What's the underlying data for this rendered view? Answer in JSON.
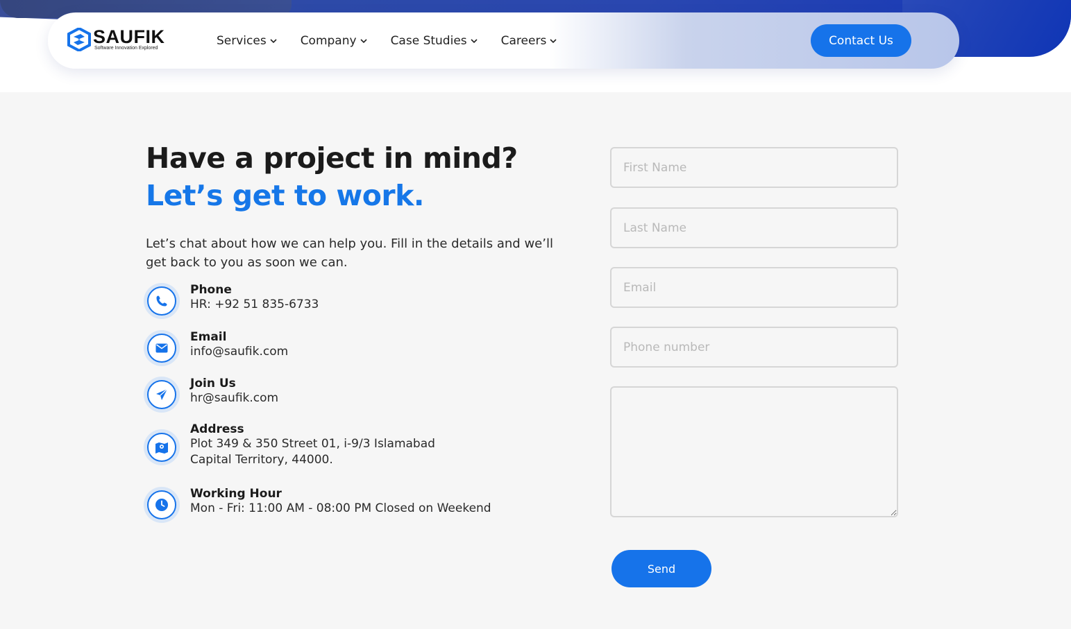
{
  "brand": {
    "name": "SAUFIK",
    "tagline": "Software Innovation Explored",
    "accent_color": "#1673ea",
    "logo_icon": "saufik-logo-icon"
  },
  "nav": {
    "items": [
      {
        "label": "Services"
      },
      {
        "label": "Company"
      },
      {
        "label": "Case Studies"
      },
      {
        "label": "Careers"
      }
    ],
    "contact_label": "Contact Us"
  },
  "hero": {
    "heading_line1": "Have a project in mind?",
    "heading_line2": "Let’s get to work.",
    "intro": "Let’s chat about how we can help you. Fill in the details and we’ll get back to you as soon we can."
  },
  "contact_info": [
    {
      "icon": "phone-icon",
      "title": "Phone",
      "lines": [
        "HR: +92 51 835-6733"
      ]
    },
    {
      "icon": "envelope-icon",
      "title": "Email",
      "lines": [
        "info@saufik.com"
      ]
    },
    {
      "icon": "paper-plane-icon",
      "title": "Join Us",
      "lines": [
        "hr@saufik.com"
      ]
    },
    {
      "icon": "map-icon",
      "title": "Address",
      "lines": [
        "Plot 349 & 350 Street 01, i-9/3 Islamabad",
        "Capital Territory, 44000."
      ]
    },
    {
      "icon": "clock-icon",
      "title": "Working Hour",
      "lines": [
        "Mon - Fri: 11:00 AM - 08:00 PM Closed on Weekend"
      ]
    }
  ],
  "form": {
    "first_name": {
      "placeholder": "First Name",
      "value": ""
    },
    "last_name": {
      "placeholder": "Last Name",
      "value": ""
    },
    "email": {
      "placeholder": "Email",
      "value": ""
    },
    "phone": {
      "placeholder": "Phone number",
      "value": ""
    },
    "message": {
      "placeholder": "",
      "value": ""
    },
    "send_label": "Send"
  }
}
